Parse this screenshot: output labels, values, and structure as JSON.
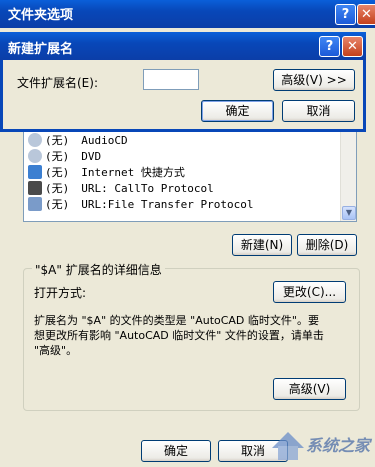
{
  "back_window": {
    "title": "文件夹选项",
    "help_btn": "?",
    "file_list": [
      {
        "ext": "(无)",
        "type": "AutoCAD 临时文件",
        "icon": "acad-icon"
      },
      {
        "ext": "(无)",
        "type": "AudioCD",
        "icon": "cd-icon"
      },
      {
        "ext": "(无)",
        "type": "DVD",
        "icon": "dvd-icon"
      },
      {
        "ext": "(无)",
        "type": "Internet 快捷方式",
        "icon": "ie-shortcut-icon"
      },
      {
        "ext": "(无)",
        "type": "URL: CallTo Protocol",
        "icon": "callto-icon"
      },
      {
        "ext": "(无)",
        "type": "URL:File Transfer Protocol",
        "icon": "url-icon"
      }
    ],
    "new_btn": "新建(N)",
    "delete_btn": "删除(D)",
    "details_group_title": "\"$A\" 扩展名的详细信息",
    "open_with_label": "打开方式:",
    "change_btn": "更改(C)...",
    "description": [
      "扩展名为 \"$A\" 的文件的类型是 \"AutoCAD 临时文件\"。要",
      "想更改所有影响 \"AutoCAD 临时文件\" 文件的设置，请单击",
      "\"高级\"。"
    ],
    "advanced_btn": "高级(V)",
    "ok_btn": "确定",
    "cancel_btn": "取消",
    "watermark": "系统之家"
  },
  "dialog": {
    "title": "新建扩展名",
    "help_btn": "?",
    "close_btn": "✕",
    "ext_label": "文件扩展名(E):",
    "ext_value": "",
    "advanced_btn": "高级(V) >>",
    "ok_btn": "确定",
    "cancel_btn": "取消"
  },
  "colors": {
    "titlebar": "#0847B8",
    "window_bg": "#ECE9D8",
    "close": "#C4401C"
  }
}
